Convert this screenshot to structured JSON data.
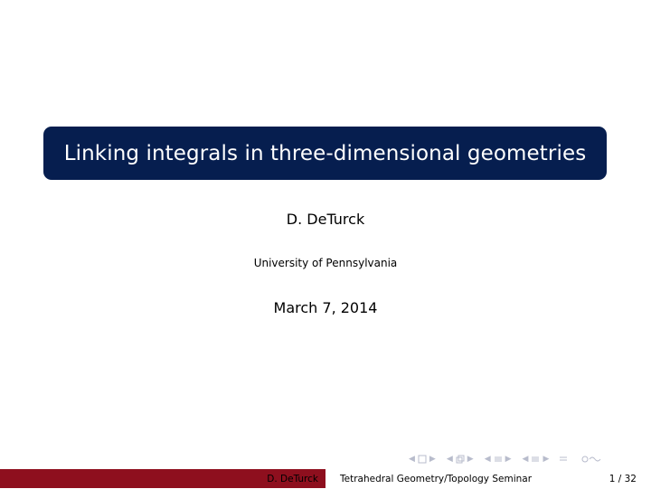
{
  "slide": {
    "title": "Linking integrals in three-dimensional geometries",
    "author": "D. DeTurck",
    "institute": "University of Pennsylvania",
    "date": "March 7, 2014"
  },
  "footer": {
    "author": "D. DeTurck",
    "seminar": "Tetrahedral Geometry/Topology Seminar",
    "page": "1 / 32"
  },
  "navigation": {
    "icons": [
      "frame-prev-icon",
      "frame-icon",
      "frame-next-icon",
      "subsection-prev-icon",
      "subsection-icon",
      "subsection-next-icon",
      "section-prev-icon",
      "section-icon",
      "section-next-icon",
      "slide-prev-icon",
      "slide-icon",
      "slide-next-icon",
      "align-icon",
      "search-icon"
    ]
  },
  "colors": {
    "title_bg": "#061e4f",
    "footer_left": "#8e0f1e",
    "nav": "#b8bccc"
  }
}
